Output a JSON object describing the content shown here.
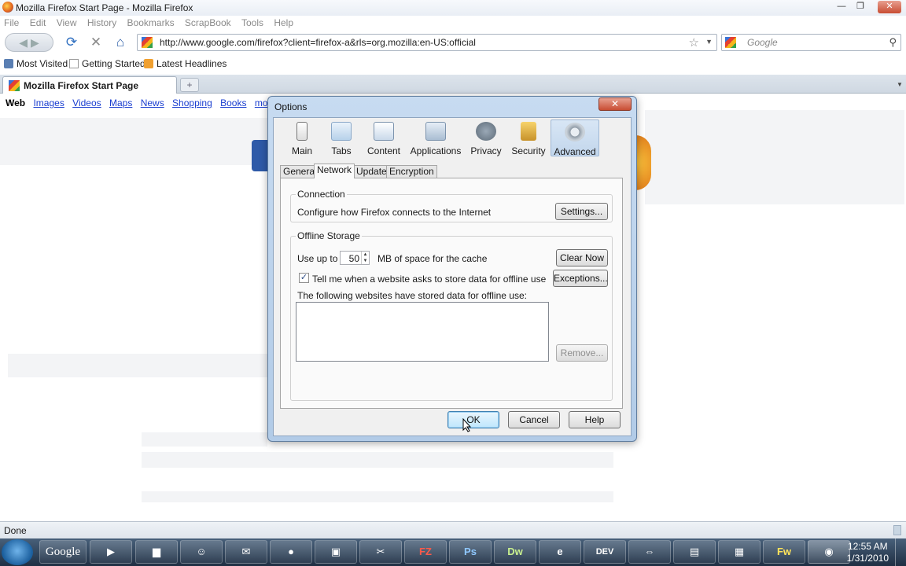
{
  "window": {
    "title": "Mozilla Firefox Start Page - Mozilla Firefox",
    "min": "—",
    "restore": "❐",
    "close": "✕"
  },
  "menu": [
    "File",
    "Edit",
    "View",
    "History",
    "Bookmarks",
    "ScrapBook",
    "Tools",
    "Help"
  ],
  "toolbar": {
    "url": "http://www.google.com/firefox?client=firefox-a&rls=org.mozilla:en-US:official",
    "search_placeholder": "Google"
  },
  "bookmarks": [
    "Most Visited",
    "Getting Started",
    "Latest Headlines"
  ],
  "tab": {
    "label": "Mozilla Firefox Start Page"
  },
  "google_nav": [
    "Web",
    "Images",
    "Videos",
    "Maps",
    "News",
    "Shopping",
    "Books",
    "more"
  ],
  "status": "Done",
  "dialog": {
    "title": "Options",
    "close": "✕",
    "panes": [
      "Main",
      "Tabs",
      "Content",
      "Applications",
      "Privacy",
      "Security",
      "Advanced"
    ],
    "subtabs": [
      "General",
      "Network",
      "Update",
      "Encryption"
    ],
    "connection": {
      "legend": "Connection",
      "text": "Configure how Firefox connects to the Internet",
      "settings_btn": "Settings..."
    },
    "offline": {
      "legend": "Offline Storage",
      "use_up_to": "Use up to",
      "cache_value": "50",
      "mb_text": "MB of space for the cache",
      "clear_btn": "Clear Now",
      "tell_me": "Tell me when a website asks to store data for offline use",
      "exceptions_btn": "Exceptions...",
      "list_label": "The following websites have stored data for offline use:",
      "remove_btn": "Remove..."
    },
    "ok": "OK",
    "cancel": "Cancel",
    "help": "Help"
  },
  "taskbar": {
    "google": "Google",
    "fz": "FZ",
    "ps": "Ps",
    "dw": "Dw",
    "dev": "DEV",
    "fw": "Fw",
    "time": "12:55 AM",
    "date": "1/31/2010"
  }
}
